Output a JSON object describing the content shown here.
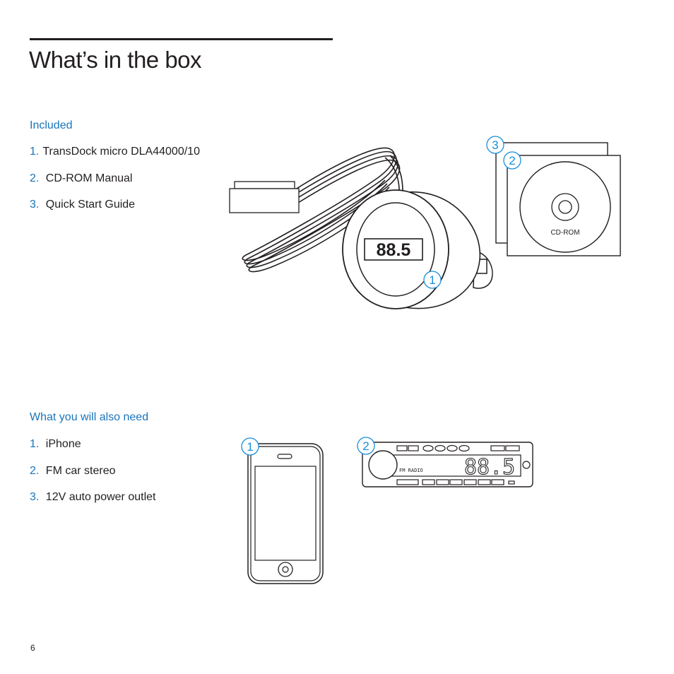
{
  "page": {
    "title": "What’s in the box",
    "page_number": "6"
  },
  "included": {
    "heading": "Included",
    "items": [
      {
        "num": "1.",
        "label": "TransDock micro DLA44000/10"
      },
      {
        "num": "2.",
        "label": "CD-ROM Manual"
      },
      {
        "num": "3.",
        "label": "Quick Start Guide"
      }
    ]
  },
  "also_need": {
    "heading": "What you will also need",
    "items": [
      {
        "num": "1.",
        "label": "iPhone"
      },
      {
        "num": "2.",
        "label": "FM car stereo"
      },
      {
        "num": "3.",
        "label": "12V auto power outlet"
      }
    ]
  },
  "illustrations": {
    "transdock": {
      "display": "88.5",
      "callout": "1"
    },
    "cdrom": {
      "disc_label": "CD-ROM",
      "callout_cd": "2",
      "callout_guide": "3"
    },
    "iphone": {
      "callout": "1"
    },
    "stereo": {
      "display": "88.5",
      "band_label": "FM RADIO",
      "callout": "2"
    }
  },
  "colors": {
    "accent": "#1a75bb",
    "callout": "#1a8fd8",
    "text": "#231f20"
  }
}
